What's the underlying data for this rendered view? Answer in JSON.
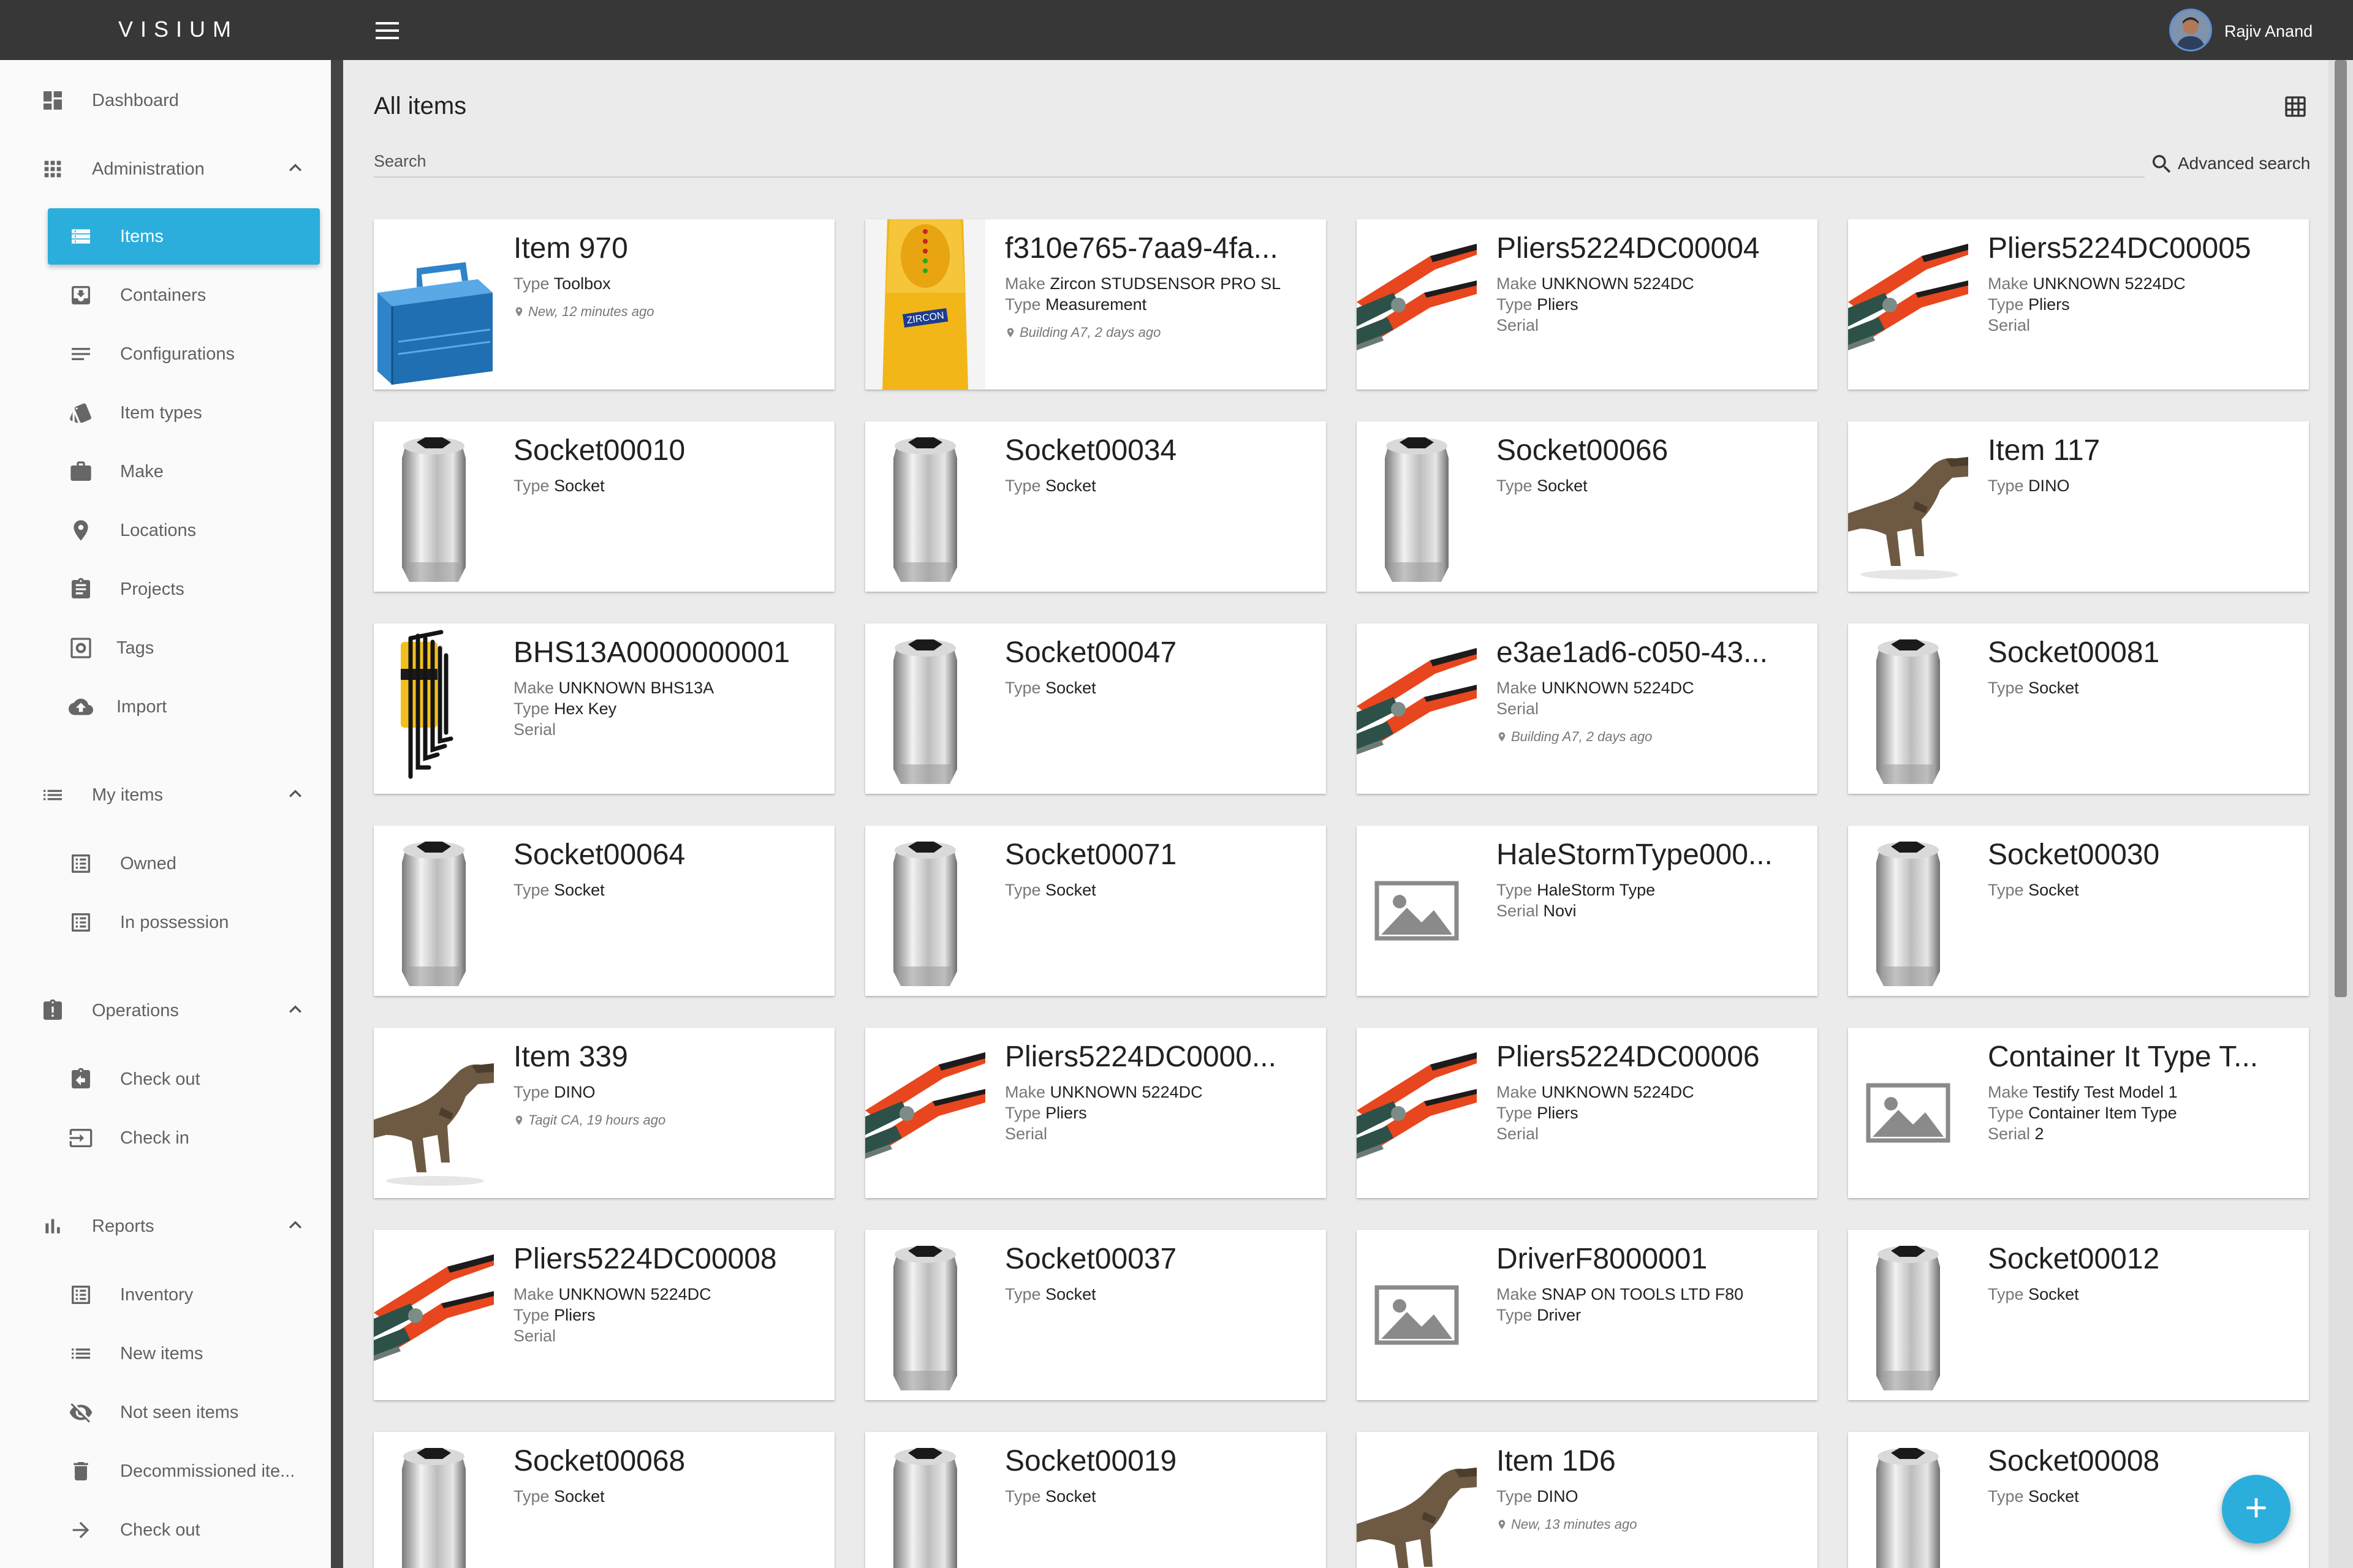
{
  "app": {
    "brand": "VISIUM",
    "user_name": "Rajiv Anand",
    "accent_color": "#2baedb",
    "topbar_color": "#373737"
  },
  "sidebar": {
    "dashboard": "Dashboard",
    "administration": {
      "label": "Administration",
      "items": [
        "Items",
        "Containers",
        "Configurations",
        "Item types",
        "Make",
        "Locations",
        "Projects",
        "Tags",
        "Import"
      ]
    },
    "my_items": {
      "label": "My items",
      "items": [
        "Owned",
        "In possession"
      ]
    },
    "operations": {
      "label": "Operations",
      "items": [
        "Check out",
        "Check in"
      ]
    },
    "reports": {
      "label": "Reports",
      "items": [
        "Inventory",
        "New items",
        "Not seen items",
        "Decommissioned ite...",
        "Check out"
      ]
    },
    "active_item": "Items"
  },
  "main": {
    "title": "All items",
    "search_label": "Search",
    "advanced_search": "Advanced search"
  },
  "fab_icon": "+",
  "cards": [
    {
      "title": "Item 970",
      "image": "toolbox",
      "lines": [
        {
          "k": "Type",
          "v": "Toolbox"
        }
      ],
      "location": "New, 12 minutes ago"
    },
    {
      "title": "f310e765-7aa9-4fa...",
      "image": "studsensor",
      "lines": [
        {
          "k": "Make",
          "v": "Zircon STUDSENSOR PRO SL"
        },
        {
          "k": "Type",
          "v": "Measurement"
        }
      ],
      "location": "Building A7, 2 days ago"
    },
    {
      "title": "Pliers5224DC00004",
      "image": "pliers",
      "lines": [
        {
          "k": "Make",
          "v": "UNKNOWN 5224DC"
        },
        {
          "k": "Type",
          "v": "Pliers"
        },
        {
          "k": "Serial",
          "v": ""
        }
      ],
      "location": ""
    },
    {
      "title": "Pliers5224DC00005",
      "image": "pliers",
      "lines": [
        {
          "k": "Make",
          "v": "UNKNOWN 5224DC"
        },
        {
          "k": "Type",
          "v": "Pliers"
        },
        {
          "k": "Serial",
          "v": ""
        }
      ],
      "location": ""
    },
    {
      "title": "Socket00010",
      "image": "socket",
      "lines": [
        {
          "k": "Type",
          "v": "Socket"
        }
      ],
      "location": ""
    },
    {
      "title": "Socket00034",
      "image": "socket",
      "lines": [
        {
          "k": "Type",
          "v": "Socket"
        }
      ],
      "location": ""
    },
    {
      "title": "Socket00066",
      "image": "socket",
      "lines": [
        {
          "k": "Type",
          "v": "Socket"
        }
      ],
      "location": ""
    },
    {
      "title": "Item 117",
      "image": "dino",
      "lines": [
        {
          "k": "Type",
          "v": "DINO"
        }
      ],
      "location": ""
    },
    {
      "title": "BHS13A0000000001",
      "image": "hexkey",
      "lines": [
        {
          "k": "Make",
          "v": "UNKNOWN BHS13A"
        },
        {
          "k": "Type",
          "v": "Hex Key"
        },
        {
          "k": "Serial",
          "v": ""
        }
      ],
      "location": ""
    },
    {
      "title": "Socket00047",
      "image": "socket",
      "lines": [
        {
          "k": "Type",
          "v": "Socket"
        }
      ],
      "location": ""
    },
    {
      "title": "e3ae1ad6-c050-43...",
      "image": "pliers",
      "lines": [
        {
          "k": "Make",
          "v": "UNKNOWN 5224DC"
        },
        {
          "k": "Serial",
          "v": ""
        }
      ],
      "location": "Building A7, 2 days ago"
    },
    {
      "title": "Socket00081",
      "image": "socket",
      "lines": [
        {
          "k": "Type",
          "v": "Socket"
        }
      ],
      "location": ""
    },
    {
      "title": "Socket00064",
      "image": "socket",
      "lines": [
        {
          "k": "Type",
          "v": "Socket"
        }
      ],
      "location": ""
    },
    {
      "title": "Socket00071",
      "image": "socket",
      "lines": [
        {
          "k": "Type",
          "v": "Socket"
        }
      ],
      "location": ""
    },
    {
      "title": "HaleStormType000...",
      "image": "placeholder",
      "lines": [
        {
          "k": "Type",
          "v": "HaleStorm Type"
        },
        {
          "k": "Serial",
          "v": "Novi"
        }
      ],
      "location": ""
    },
    {
      "title": "Socket00030",
      "image": "socket",
      "lines": [
        {
          "k": "Type",
          "v": "Socket"
        }
      ],
      "location": ""
    },
    {
      "title": "Item 339",
      "image": "dino",
      "lines": [
        {
          "k": "Type",
          "v": "DINO"
        }
      ],
      "location": "Tagit CA, 19 hours ago"
    },
    {
      "title": "Pliers5224DC0000...",
      "image": "pliers",
      "lines": [
        {
          "k": "Make",
          "v": "UNKNOWN 5224DC"
        },
        {
          "k": "Type",
          "v": "Pliers"
        },
        {
          "k": "Serial",
          "v": ""
        }
      ],
      "location": ""
    },
    {
      "title": "Pliers5224DC00006",
      "image": "pliers",
      "lines": [
        {
          "k": "Make",
          "v": "UNKNOWN 5224DC"
        },
        {
          "k": "Type",
          "v": "Pliers"
        },
        {
          "k": "Serial",
          "v": ""
        }
      ],
      "location": ""
    },
    {
      "title": "Container It Type T...",
      "image": "placeholder",
      "lines": [
        {
          "k": "Make",
          "v": "Testify Test Model 1"
        },
        {
          "k": "Type",
          "v": "Container Item Type"
        },
        {
          "k": "Serial",
          "v": "2"
        }
      ],
      "location": ""
    },
    {
      "title": "Pliers5224DC00008",
      "image": "pliers",
      "lines": [
        {
          "k": "Make",
          "v": "UNKNOWN 5224DC"
        },
        {
          "k": "Type",
          "v": "Pliers"
        },
        {
          "k": "Serial",
          "v": ""
        }
      ],
      "location": ""
    },
    {
      "title": "Socket00037",
      "image": "socket",
      "lines": [
        {
          "k": "Type",
          "v": "Socket"
        }
      ],
      "location": ""
    },
    {
      "title": "DriverF8000001",
      "image": "placeholder",
      "lines": [
        {
          "k": "Make",
          "v": "SNAP ON TOOLS LTD F80"
        },
        {
          "k": "Type",
          "v": "Driver"
        }
      ],
      "location": ""
    },
    {
      "title": "Socket00012",
      "image": "socket",
      "lines": [
        {
          "k": "Type",
          "v": "Socket"
        }
      ],
      "location": ""
    },
    {
      "title": "Socket00068",
      "image": "socket",
      "lines": [
        {
          "k": "Type",
          "v": "Socket"
        }
      ],
      "location": ""
    },
    {
      "title": "Socket00019",
      "image": "socket",
      "lines": [
        {
          "k": "Type",
          "v": "Socket"
        }
      ],
      "location": ""
    },
    {
      "title": "Item 1D6",
      "image": "dino",
      "lines": [
        {
          "k": "Type",
          "v": "DINO"
        }
      ],
      "location": "New, 13 minutes ago"
    },
    {
      "title": "Socket00008",
      "image": "socket",
      "lines": [
        {
          "k": "Type",
          "v": "Socket"
        }
      ],
      "location": ""
    }
  ]
}
